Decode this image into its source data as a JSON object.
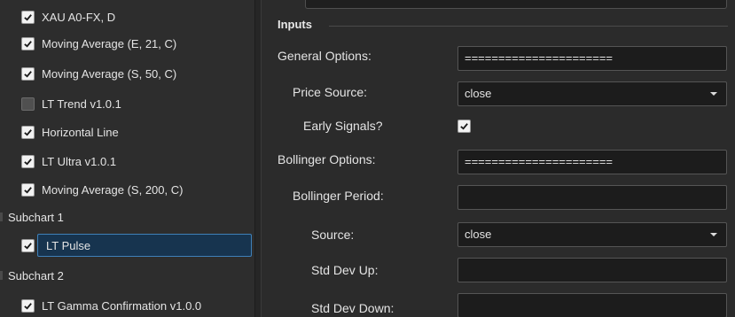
{
  "tree": {
    "items": [
      {
        "label": "XAU A0-FX, D",
        "checked": true
      },
      {
        "label": "Moving Average (E, 21, C)",
        "checked": true
      },
      {
        "label": "Moving Average (S, 50, C)",
        "checked": true
      },
      {
        "label": "LT Trend v1.0.1",
        "checked": false
      },
      {
        "label": "Horizontal Line",
        "checked": true
      },
      {
        "label": "LT Ultra v1.0.1",
        "checked": true
      },
      {
        "label": "Moving Average (S, 200, C)",
        "checked": true
      }
    ],
    "subchart1": {
      "label": "Subchart 1",
      "items": [
        {
          "label": "LT Pulse",
          "checked": true,
          "selected": true
        }
      ]
    },
    "subchart2": {
      "label": "Subchart 2",
      "items": [
        {
          "label": "LT Gamma Confirmation v1.0.0",
          "checked": true
        }
      ]
    }
  },
  "inputs": {
    "header": "Inputs",
    "general_options": {
      "label": "General Options:",
      "value": "======================"
    },
    "price_source": {
      "label": "Price Source:",
      "value": "close"
    },
    "early_signals": {
      "label": "Early Signals?",
      "checked": true
    },
    "bollinger_options": {
      "label": "Bollinger Options:",
      "value": "======================"
    },
    "bollinger_period": {
      "label": "Bollinger Period:",
      "value": ""
    },
    "source": {
      "label": "Source:",
      "value": "close"
    },
    "std_dev_up": {
      "label": "Std Dev Up:",
      "value": ""
    },
    "std_dev_down": {
      "label": "Std Dev Down:",
      "value": ""
    }
  },
  "colors": {
    "selection_fill": "#17344f",
    "selection_border": "#3f80b8",
    "panel_bg": "#2b2b2b",
    "field_bg": "#1c1c1c"
  }
}
